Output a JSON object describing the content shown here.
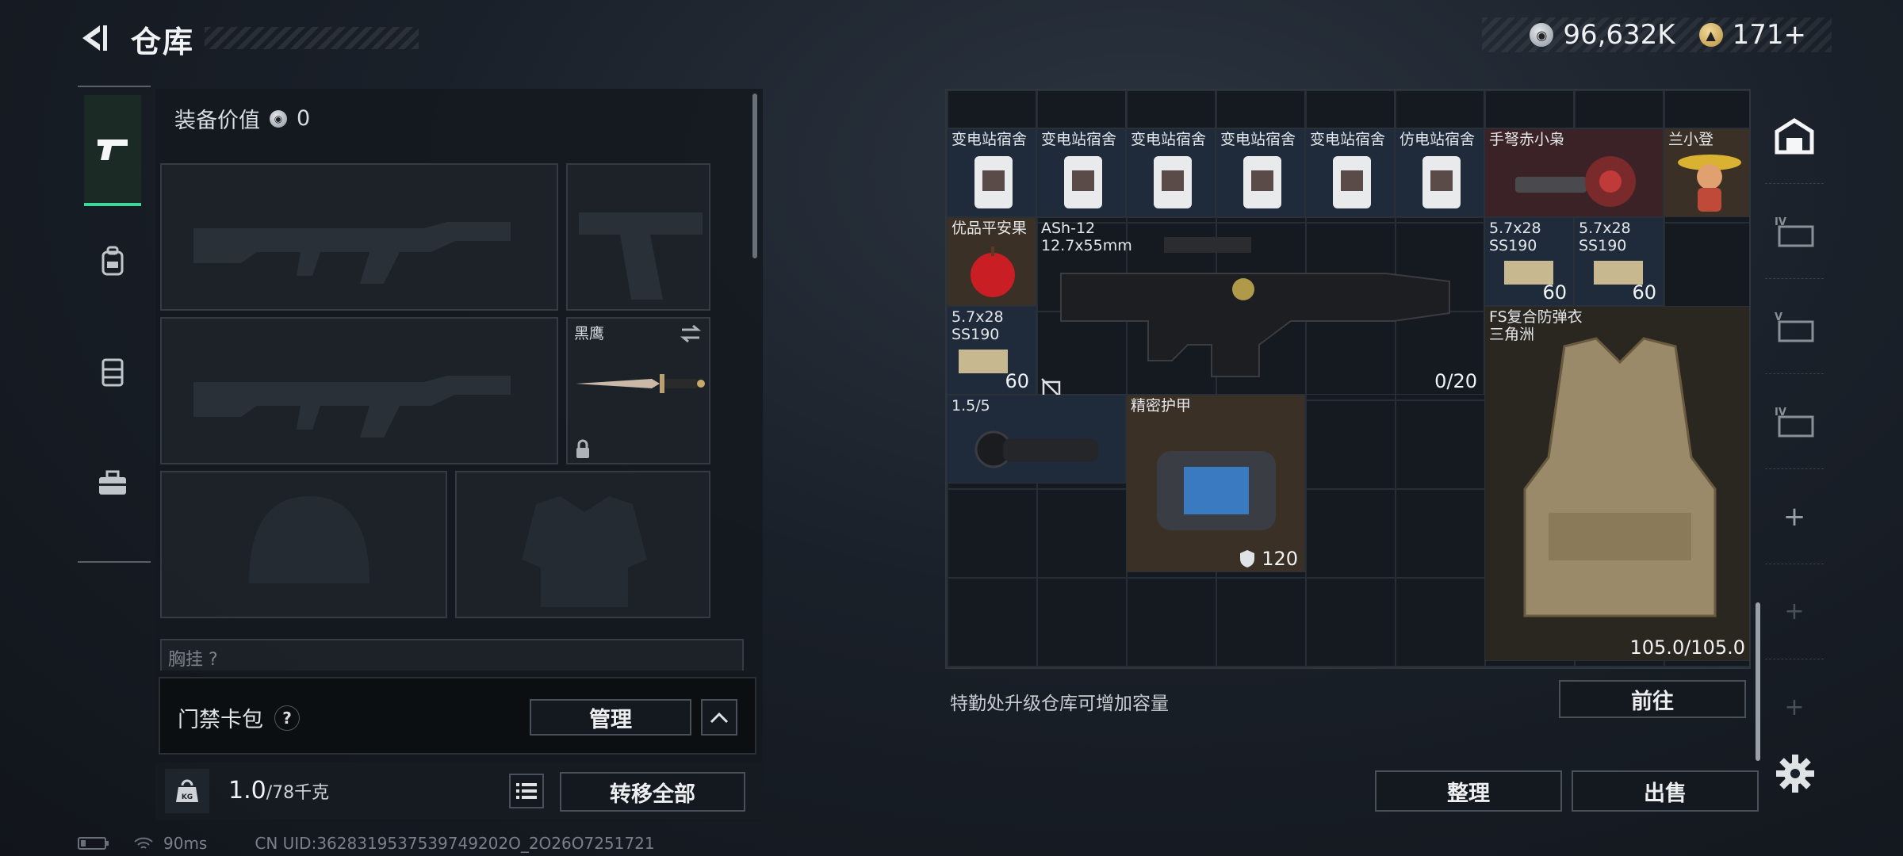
{
  "header": {
    "title": "仓库",
    "currency_silver": "96,632K",
    "currency_gold": "171+"
  },
  "left_tabs": [
    "weapon-tab",
    "backpack-tab",
    "rig-tab",
    "case-tab"
  ],
  "equipment": {
    "value_label": "装备价值",
    "value": "0",
    "knife_label": "黑鹰",
    "chest_label": "胸挂",
    "chest_hint": "?"
  },
  "card_pack": {
    "label": "门禁卡包",
    "help": "?",
    "manage_button": "管理"
  },
  "weight": {
    "current": "1.0",
    "max": "/78千克",
    "transfer_all_button": "转移全部"
  },
  "footer": {
    "ping": "90ms",
    "uid": "CN UID:3628319537539749202O_2O26O7251721"
  },
  "grid": {
    "row1": [
      "变电站宿舍",
      "变电站宿舍",
      "变电站宿舍",
      "变电站宿舍",
      "变电站宿舍",
      "仿电站宿舍"
    ],
    "crossbow": "手弩赤小枭",
    "lanxiaodeng": "兰小登",
    "apple": "优品平安果",
    "ash12_name": "ASh-12",
    "ash12_caliber": "12.7x55mm",
    "ash12_ammo": "0/20",
    "ammo_a_label1": "5.7x28",
    "ammo_a_label2": "SS190",
    "ammo_a_count": "60",
    "ammo_b_label1": "5.7x28",
    "ammo_b_label2": "SS190",
    "ammo_b_count": "60",
    "ammo_c_label1": "5.7x28",
    "ammo_c_label2": "SS190",
    "ammo_c_count": "60",
    "scope_label": "1.5/5",
    "armor_plate_label": "精密护甲",
    "armor_plate_value": "120",
    "vest_label1": "FS复合防弹衣",
    "vest_label2": "三角洲",
    "vest_durability": "105.0/105.0"
  },
  "right_actions": {
    "note": "特勤处升级仓库可增加容量",
    "goto_button": "前往",
    "organize_button": "整理",
    "sell_button": "出售"
  },
  "right_tabs": [
    "warehouse-tab",
    "storage-iv-1",
    "storage-v",
    "storage-iv-2",
    "add-1",
    "add-2",
    "add-3"
  ],
  "colors": {
    "accent_green": "#3fd69b",
    "red_cell": "#3a2226",
    "gold_cell": "#3a3026",
    "blue_cell": "#1f2a3a"
  }
}
